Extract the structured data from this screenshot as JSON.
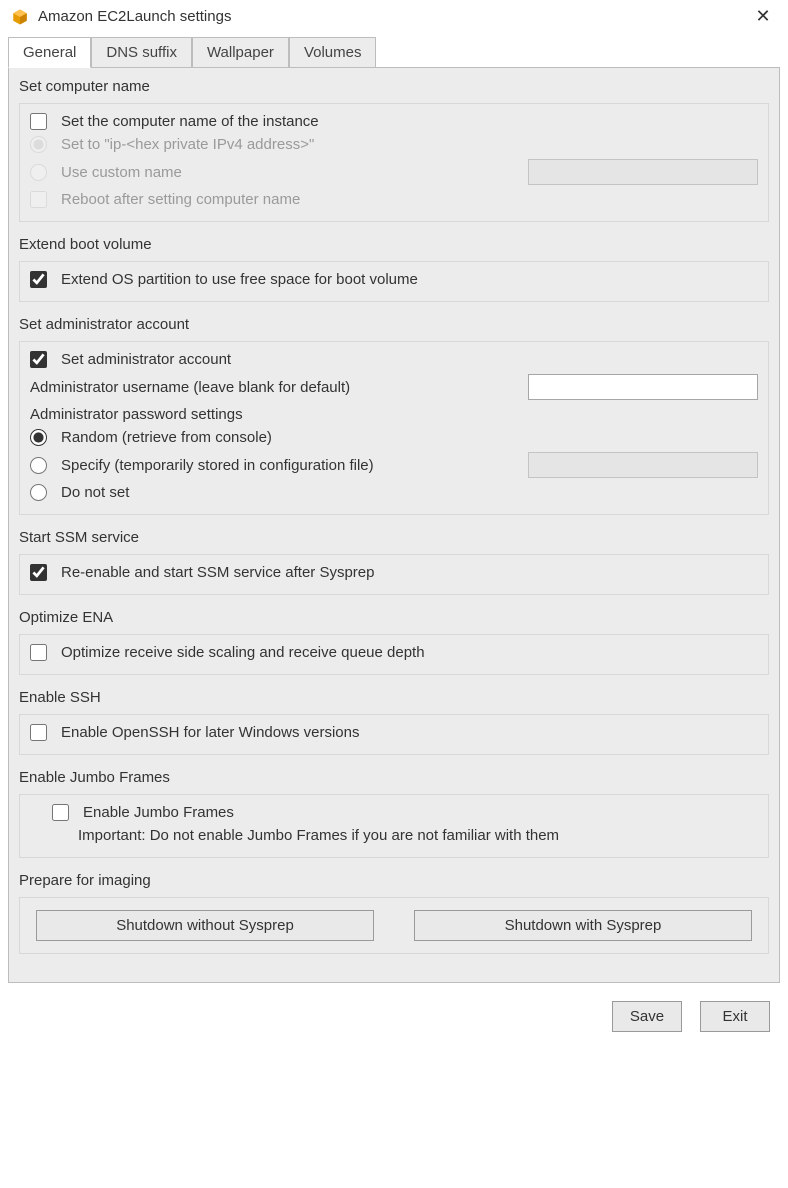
{
  "window": {
    "title": "Amazon EC2Launch settings",
    "icon": "aws-box-icon"
  },
  "tabs": [
    {
      "label": "General",
      "active": true
    },
    {
      "label": "DNS suffix",
      "active": false
    },
    {
      "label": "Wallpaper",
      "active": false
    },
    {
      "label": "Volumes",
      "active": false
    }
  ],
  "groups": {
    "computer_name": {
      "title": "Set computer name",
      "set_name_label": "Set the computer name of the instance",
      "set_name_checked": false,
      "option_ip_label": "Set to \"ip-<hex private IPv4 address>\"",
      "option_ip_selected": true,
      "option_custom_label": "Use custom name",
      "option_custom_selected": false,
      "custom_name_value": "",
      "reboot_label": "Reboot after setting computer name",
      "reboot_checked": false
    },
    "extend_boot": {
      "title": "Extend boot volume",
      "extend_label": "Extend OS partition to use free space for boot volume",
      "extend_checked": true
    },
    "admin": {
      "title": "Set administrator account",
      "set_admin_label": "Set administrator account",
      "set_admin_checked": true,
      "username_label": "Administrator username (leave blank for default)",
      "username_value": "",
      "password_heading": "Administrator password settings",
      "pw_random_label": "Random (retrieve from console)",
      "pw_random_selected": true,
      "pw_specify_label": "Specify (temporarily stored in configuration file)",
      "pw_specify_selected": false,
      "pw_specify_value": "",
      "pw_none_label": "Do not set",
      "pw_none_selected": false
    },
    "ssm": {
      "title": "Start SSM service",
      "ssm_label": "Re-enable and start SSM service after Sysprep",
      "ssm_checked": true
    },
    "ena": {
      "title": "Optimize ENA",
      "ena_label": "Optimize receive side scaling and receive queue depth",
      "ena_checked": false
    },
    "ssh": {
      "title": "Enable SSH",
      "ssh_label": "Enable OpenSSH for later Windows versions",
      "ssh_checked": false
    },
    "jumbo": {
      "title": "Enable Jumbo Frames",
      "jumbo_label": "Enable Jumbo Frames",
      "jumbo_checked": false,
      "jumbo_note": "Important: Do not enable Jumbo Frames if you are not familiar with them"
    },
    "imaging": {
      "title": "Prepare for imaging",
      "shutdown_no_sysprep": "Shutdown without Sysprep",
      "shutdown_sysprep": "Shutdown with Sysprep"
    }
  },
  "footer": {
    "save": "Save",
    "exit": "Exit"
  }
}
